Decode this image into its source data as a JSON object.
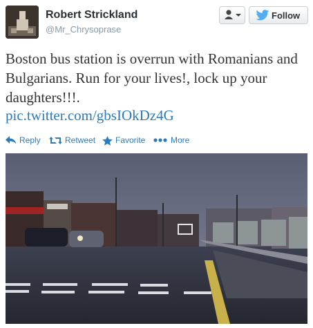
{
  "user": {
    "name": "Robert Strickland",
    "handle": "@Mr_Chrysoprase"
  },
  "buttons": {
    "follow_label": "Follow"
  },
  "tweet": {
    "text": "Boston bus station is overrun with Romanians and Bulgarians. Run for your lives!, lock up your daughters!!!.",
    "link": "pic.twitter.com/gbsIOkDz4G"
  },
  "actions": [
    {
      "label": "Reply",
      "icon": "reply-icon"
    },
    {
      "label": "Retweet",
      "icon": "retweet-icon"
    },
    {
      "label": "Favorite",
      "icon": "star-icon"
    },
    {
      "label": "More",
      "icon": "more-dots-icon"
    }
  ],
  "colors": {
    "link": "#2b7bb9",
    "twitter_blue": "#55acee"
  }
}
